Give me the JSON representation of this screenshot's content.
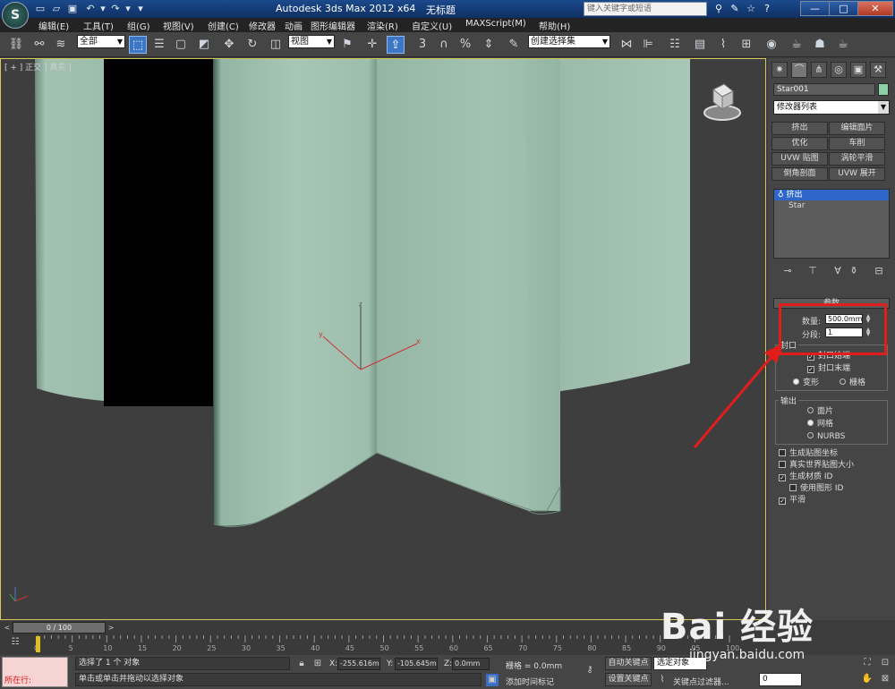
{
  "title_bar": {
    "app_title": "Autodesk 3ds Max  2012 x64",
    "file_name": "无标题",
    "search_placeholder": "键入关键字或短语",
    "minimize": "—",
    "maximize": "□",
    "close": "✕"
  },
  "menu": {
    "items": [
      "编辑(E)",
      "工具(T)",
      "组(G)",
      "视图(V)",
      "创建(C)",
      "修改器",
      "动画",
      "图形编辑器",
      "渲染(R)",
      "自定义(U)",
      "MAXScript(M)",
      "帮助(H)"
    ]
  },
  "toolbar": {
    "selection_filter": "全部",
    "ref_coord": "视图",
    "named_selection": "创建选择集",
    "snap_label": "3",
    "percent_label": "%"
  },
  "viewport": {
    "label": "[ + ] 正交 ] 真实 ]",
    "axis_x": "x",
    "axis_y": "y",
    "axis_z": "z"
  },
  "command_panel": {
    "object_name": "Star001",
    "object_color": "#8dd0a8",
    "modifier_list": "修改器列表",
    "modifier_buttons": [
      "挤出",
      "编辑面片",
      "优化",
      "车削",
      "UVW 贴图",
      "涡轮平滑",
      "倒角剖面",
      "UVW 展开"
    ],
    "stack": [
      "挤出",
      "Star"
    ],
    "rollout_title": "参数",
    "amount_label": "数量:",
    "amount_value": "500.0mm",
    "segments_label": "分段:",
    "segments_value": "1",
    "capping": {
      "title": "封口",
      "cap_start": "封口始端",
      "cap_end": "封口末端",
      "morph": "变形",
      "grid": "栅格"
    },
    "output": {
      "title": "输出",
      "patch": "面片",
      "mesh": "网格",
      "nurbs": "NURBS"
    },
    "options": {
      "gen_mapping": "生成贴图坐标",
      "real_world": "真实世界贴图大小",
      "gen_mat_id": "生成材质 ID",
      "use_shape_id": "使用图形 ID",
      "smooth": "平滑"
    }
  },
  "timeline": {
    "frame_display": "0 / 100",
    "ticks": [
      "0",
      "5",
      "10",
      "15",
      "20",
      "25",
      "30",
      "35",
      "40",
      "45",
      "50",
      "55",
      "60",
      "65",
      "70",
      "75",
      "80",
      "85",
      "90",
      "95",
      "100"
    ]
  },
  "status_bar": {
    "listener": "所在行:",
    "selection_status": "选择了 1 个 对象",
    "prompt": "单击或单击并拖动以选择对象",
    "x_label": "X:",
    "x_value": "-255.616m",
    "y_label": "Y:",
    "y_value": "-105.645m",
    "z_label": "Z:",
    "z_value": "0.0mm",
    "grid": "栅格 = 0.0mm",
    "add_time_tag": "添加时间标记",
    "auto_key": "自动关键点",
    "set_key": "设置关键点",
    "selected_obj": "选定对象",
    "key_filters": "关键点过滤器...",
    "frame_field": "0"
  },
  "watermark": {
    "brand": "Bai 经验",
    "site": "jingyan.baidu.com"
  }
}
